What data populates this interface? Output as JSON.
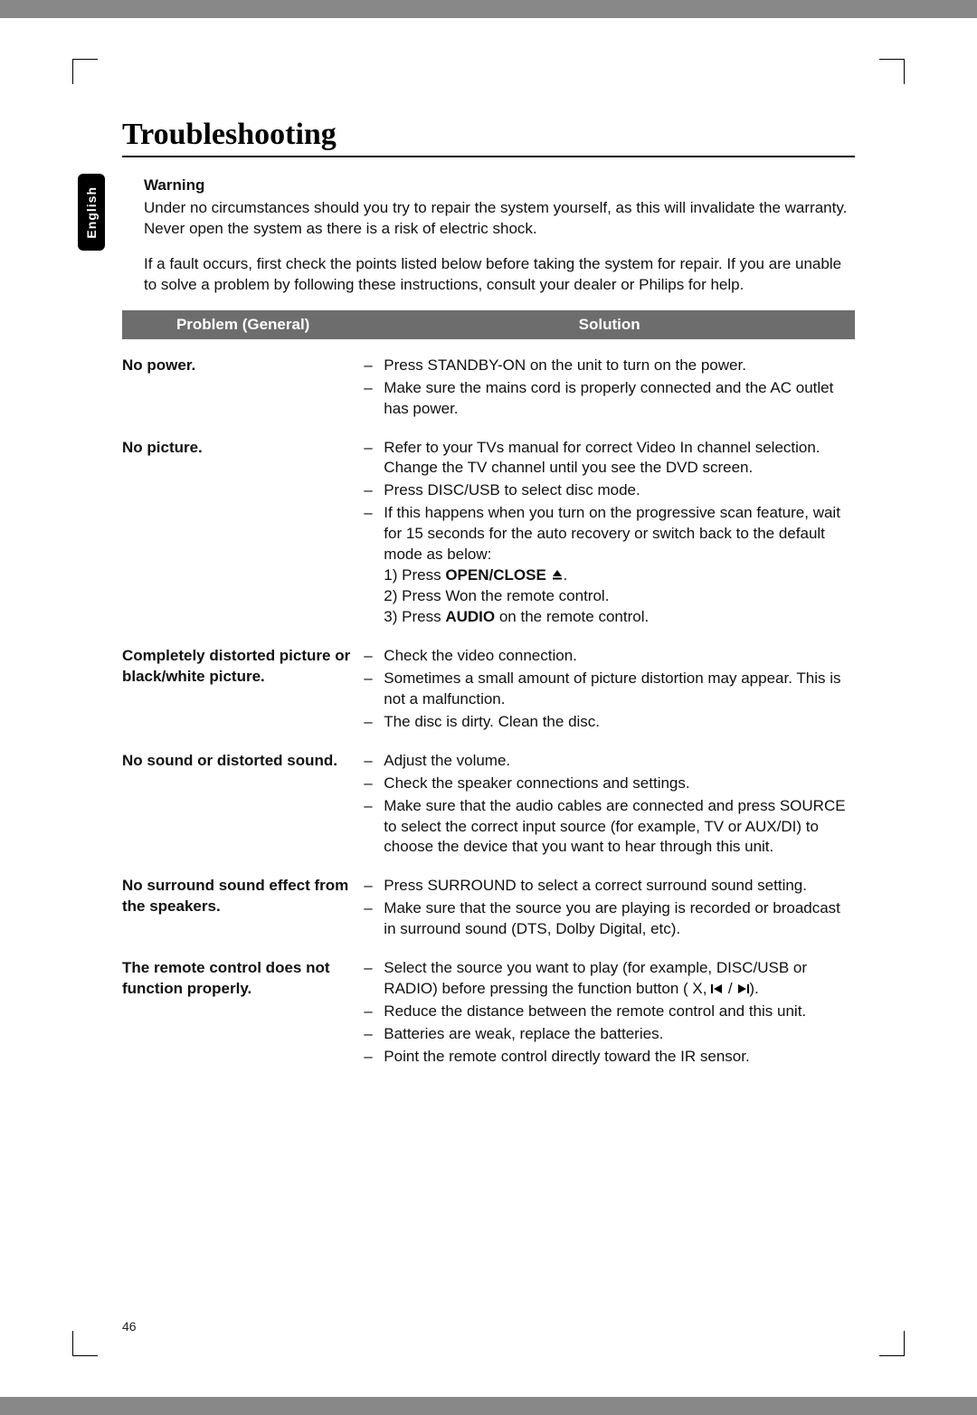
{
  "language_tab": "English",
  "title": "Troubleshooting",
  "warning": {
    "heading": "Warning",
    "p1": "Under no circumstances should you try to repair the system yourself, as this will invalidate the warranty. Never open the system as there is a risk of electric shock.",
    "p2": "If a fault occurs, first check the points listed below before taking the system for repair. If you are unable to solve a problem by following these instructions, consult your dealer or Philips for help."
  },
  "table": {
    "header_problem": "Problem (General)",
    "header_solution": "Solution",
    "rows": [
      {
        "problem": "No power.",
        "solutions": [
          "Press STANDBY-ON on the unit to turn on the power.",
          "Make sure the mains cord is properly connected and the AC outlet has power."
        ]
      },
      {
        "problem": "No picture.",
        "solutions": [
          "Refer to your TVs manual for correct Video In channel selection. Change the TV channel until you see the DVD screen.",
          "Press DISC/USB to select disc mode.",
          "If this happens when you turn on the progressive scan feature, wait for 15 seconds for the auto recovery or switch back to the default mode as below:"
        ],
        "substeps": [
          {
            "n": "1)",
            "pre": "Press ",
            "bold": "OPEN/CLOSE",
            "icon": "eject",
            "post": "."
          },
          {
            "n": "2)",
            "pre": "Press  Won the remote control.",
            "bold": "",
            "icon": "",
            "post": ""
          },
          {
            "n": "3)",
            "pre": "Press ",
            "bold": "AUDIO",
            "icon": "",
            "post": " on the remote control."
          }
        ]
      },
      {
        "problem": "Completely distorted picture or black/white picture.",
        "solutions": [
          "Check the video connection.",
          "Sometimes a small amount of picture distortion may appear. This is not a malfunction.",
          "The disc is dirty. Clean the disc."
        ]
      },
      {
        "problem": "No sound or distorted sound.",
        "solutions": [
          "Adjust the volume.",
          "Check the speaker connections and settings.",
          "Make sure that the audio cables are connected and press SOURCE to select the correct input source (for example, TV or AUX/DI) to choose the device that you want to hear through this unit."
        ]
      },
      {
        "problem": "No surround sound effect from the speakers.",
        "solutions": [
          "Press SURROUND to select a correct surround sound setting.",
          "Make sure that the source you are playing is recorded or broadcast in surround sound (DTS, Dolby Digital, etc)."
        ]
      },
      {
        "problem": "The remote control does not function properly.",
        "solutions": [
          {
            "pre": "Select the source you want to play (for example, DISC/USB or RADIO) before pressing the function button ( X,  ",
            "icon": "prev-next",
            "post": ")."
          },
          "Reduce the distance between the remote control and this unit.",
          "Batteries are weak, replace the batteries.",
          "Point the remote control directly toward the IR sensor."
        ]
      }
    ]
  },
  "page_number": "46"
}
